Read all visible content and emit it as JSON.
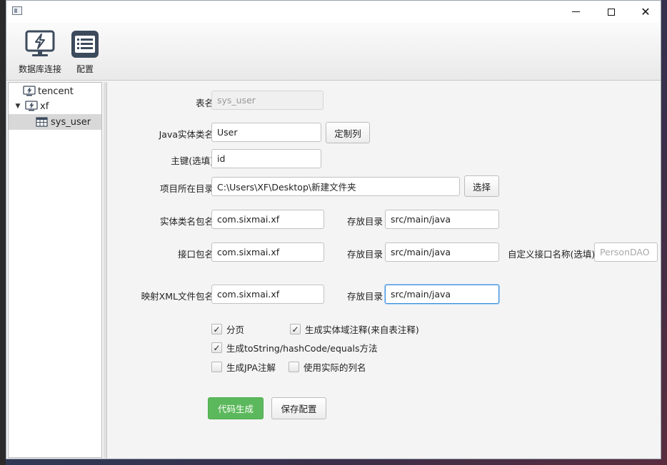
{
  "window": {
    "controls": {
      "minimize": "minimize",
      "maximize": "maximize",
      "close": "✕"
    }
  },
  "toolbar": {
    "db_connect_label": "数据库连接",
    "config_label": "配置"
  },
  "tree": {
    "items": [
      {
        "label": "tencent",
        "icon": "db-connection-icon",
        "level": 0,
        "expanded": false
      },
      {
        "label": "xf",
        "icon": "db-connection-icon",
        "level": 0,
        "expanded": true
      },
      {
        "label": "sys_user",
        "icon": "table-icon",
        "level": 1,
        "selected": true
      }
    ]
  },
  "form": {
    "table_name": {
      "label": "表名",
      "value": "sys_user"
    },
    "entity_class": {
      "label": "Java实体类名",
      "value": "User",
      "button": "定制列"
    },
    "primary_key": {
      "label": "主键(选填)",
      "value": "id"
    },
    "project_dir": {
      "label": "项目所在目录",
      "value": "C:\\Users\\XF\\Desktop\\新建文件夹",
      "button": "选择"
    },
    "entity_package": {
      "label": "实体类名包名",
      "value": "com.sixmai.xf",
      "dir_label": "存放目录",
      "dir_value": "src/main/java"
    },
    "interface_package": {
      "label": "接口包名",
      "value": "com.sixmai.xf",
      "dir_label": "存放目录",
      "dir_value": "src/main/java",
      "custom_label": "自定义接口名称(选填)",
      "custom_placeholder": "PersonDAO"
    },
    "xml_package": {
      "label": "映射XML文件包名",
      "value": "com.sixmai.xf",
      "dir_label": "存放目录",
      "dir_value": "src/main/java"
    }
  },
  "options": {
    "paging": {
      "label": "分页",
      "checked": true
    },
    "entity_comment": {
      "label": "生成实体域注释(来自表注释)",
      "checked": true
    },
    "tostring": {
      "label": "生成toString/hashCode/equals方法",
      "checked": true
    },
    "jpa": {
      "label": "生成JPA注解",
      "checked": false
    },
    "actual_column": {
      "label": "使用实际的列名",
      "checked": false
    }
  },
  "actions": {
    "generate": "代码生成",
    "save_config": "保存配置"
  },
  "colors": {
    "generate_bg": "#5cb85c",
    "focus_border": "#3d8fe0",
    "icon_dark": "#3c4a5c"
  }
}
